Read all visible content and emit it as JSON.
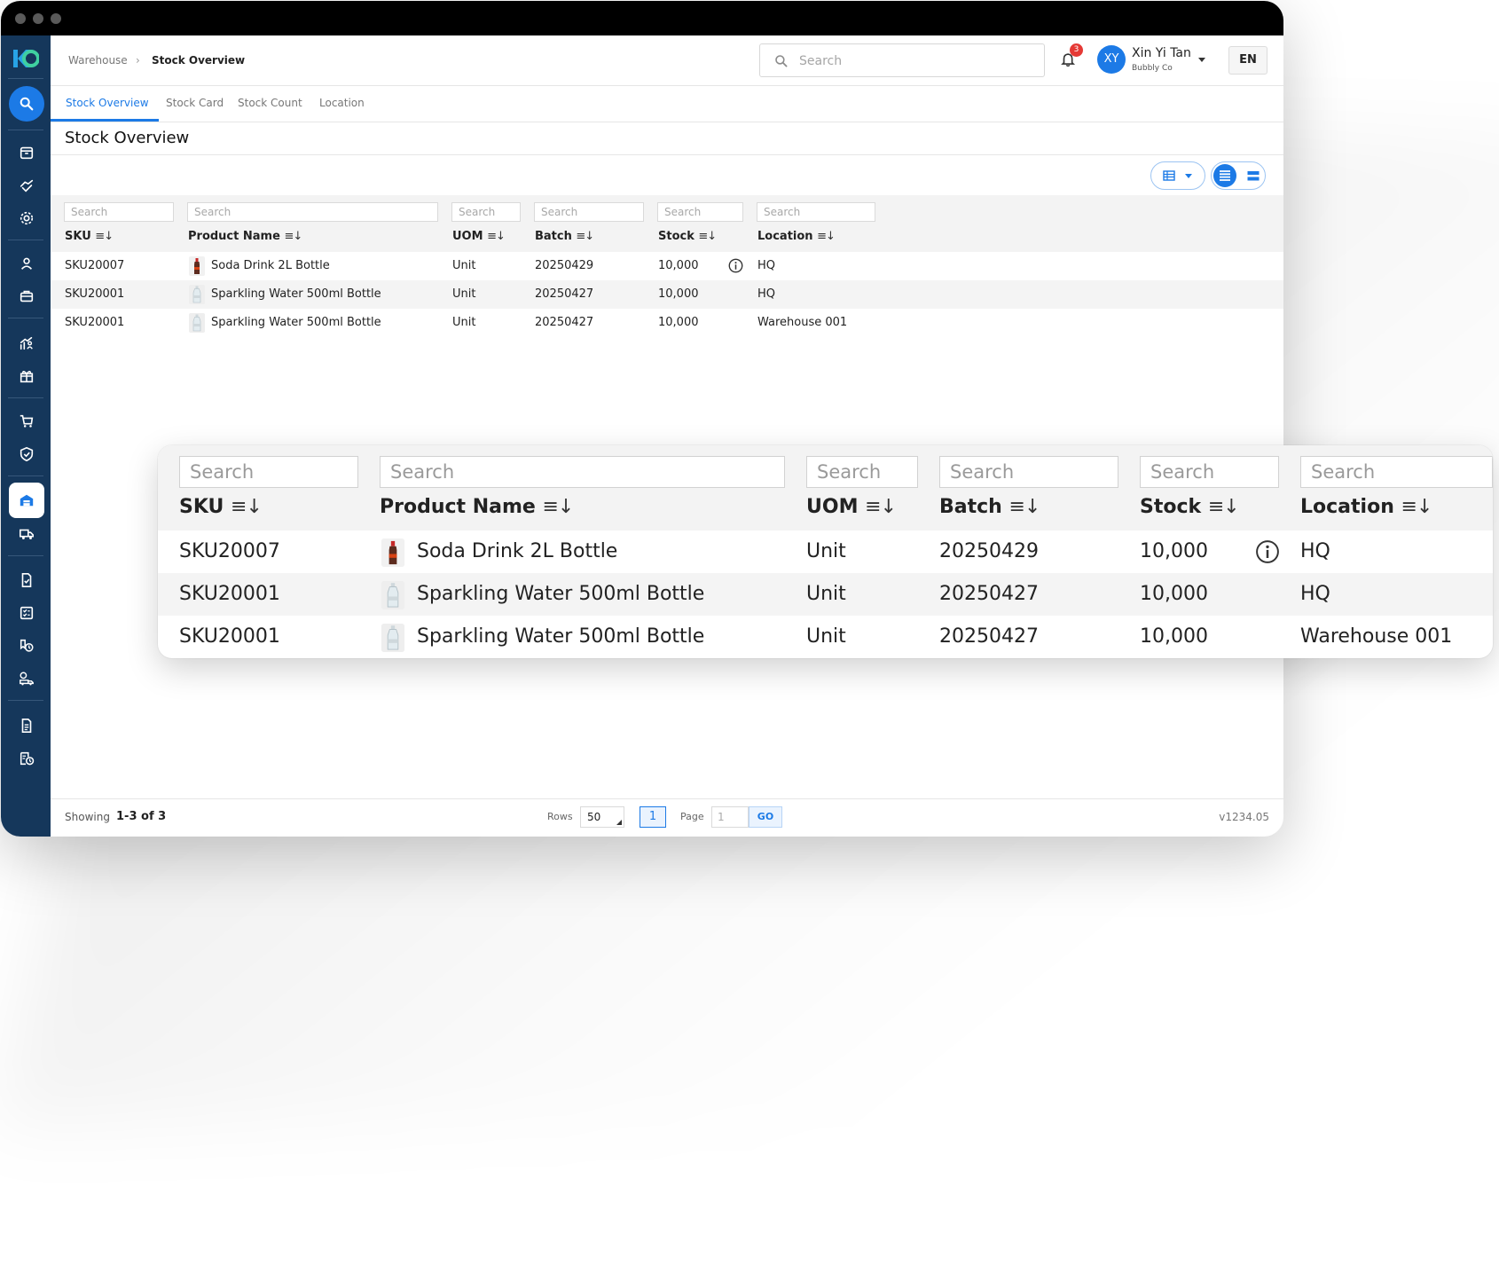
{
  "breadcrumb": {
    "parent": "Warehouse",
    "current": "Stock Overview"
  },
  "search": {
    "placeholder": "Search"
  },
  "notifications": {
    "count": "3"
  },
  "user": {
    "initials": "XY",
    "name": "Xin Yi Tan",
    "company": "Bubbly Co"
  },
  "language": "EN",
  "tabs": [
    "Stock Overview",
    "Stock Card",
    "Stock Count",
    "Location"
  ],
  "page_title": "Stock Overview",
  "columns": [
    {
      "label": "SKU",
      "filter_placeholder": "Search"
    },
    {
      "label": "Product Name",
      "filter_placeholder": "Search"
    },
    {
      "label": "UOM",
      "filter_placeholder": "Search"
    },
    {
      "label": "Batch",
      "filter_placeholder": "Search"
    },
    {
      "label": "Stock",
      "filter_placeholder": "Search"
    },
    {
      "label": "Location",
      "filter_placeholder": "Search"
    }
  ],
  "rows": [
    {
      "sku": "SKU20007",
      "product": "Soda Drink 2L Bottle",
      "uom": "Unit",
      "batch": "20250429",
      "stock": "10,000",
      "location": "HQ",
      "info": true
    },
    {
      "sku": "SKU20001",
      "product": "Sparkling Water 500ml Bottle",
      "uom": "Unit",
      "batch": "20250427",
      "stock": "10,000",
      "location": "HQ",
      "info": false
    },
    {
      "sku": "SKU20001",
      "product": "Sparkling Water 500ml Bottle",
      "uom": "Unit",
      "batch": "20250427",
      "stock": "10,000",
      "location": "Warehouse 001",
      "info": false
    }
  ],
  "footer": {
    "showing_label": "Showing",
    "showing_range": "1-3 of 3",
    "rows_label": "Rows",
    "rows_value": "50",
    "current_page": "1",
    "page_label": "Page",
    "page_input": "1",
    "go_label": "GO",
    "version": "v1234.05"
  },
  "colors": {
    "sidebar": "#15375b",
    "accent": "#1c7ae6",
    "badge": "#e53935"
  },
  "icons": [
    "logo-icon",
    "search-icon",
    "archive-icon",
    "handshake-icon",
    "settings-gear-icon",
    "user-icon",
    "briefcase-icon",
    "analytics-people-icon",
    "gift-icon",
    "cart-icon",
    "shield-check-icon",
    "warehouse-icon",
    "truck-icon",
    "document-check-icon",
    "checklist-icon",
    "tag-clock-icon",
    "delivery-truck-icon",
    "document-icon",
    "report-clock-icon"
  ]
}
